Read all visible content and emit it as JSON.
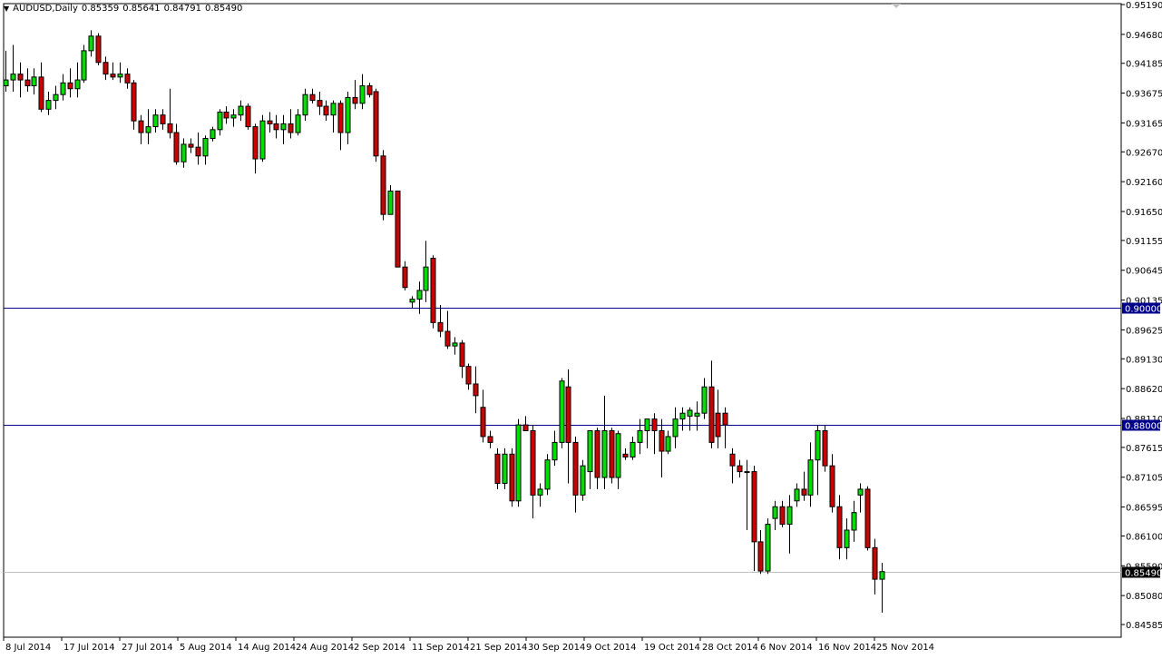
{
  "header": {
    "symbol": "AUDUSD,Daily",
    "open": "0.85359",
    "high": "0.85641",
    "low": "0.84791",
    "close": "0.85490"
  },
  "chart_data": {
    "type": "candlestick",
    "y_axis": {
      "range": [
        0.8443,
        0.9519
      ],
      "tick_labels": [
        "0.95190",
        "0.94680",
        "0.94185",
        "0.93675",
        "0.93165",
        "0.92670",
        "0.92160",
        "0.91650",
        "0.91155",
        "0.90645",
        "0.90135",
        "0.89625",
        "0.89130",
        "0.88620",
        "0.88110",
        "0.87615",
        "0.87105",
        "0.86595",
        "0.86100",
        "0.85590",
        "0.85080",
        "0.84585"
      ]
    },
    "x_axis": {
      "tick_labels": [
        "8 Jul 2014",
        "17 Jul 2014",
        "27 Jul 2014",
        "5 Aug 2014",
        "14 Aug 2014",
        "24 Aug 2014",
        "2 Sep 2014",
        "11 Sep 2014",
        "21 Sep 2014",
        "30 Sep 2014",
        "9 Oct 2014",
        "19 Oct 2014",
        "28 Oct 2014",
        "6 Nov 2014",
        "16 Nov 2014",
        "25 Nov 2014"
      ]
    },
    "horizontal_lines": [
      {
        "price": 0.9,
        "label": "0.90000",
        "color": "#00008b"
      },
      {
        "price": 0.88,
        "label": "0.88000",
        "color": "#00008b"
      },
      {
        "price": 0.8549,
        "label": "0.85490",
        "color": "#c0c0c0"
      }
    ],
    "colors": {
      "bull": "#00dd00",
      "bear": "#cc0000",
      "wick": "#000000"
    },
    "candles": [
      {
        "o": 0.938,
        "h": 0.944,
        "l": 0.937,
        "c": 0.939
      },
      {
        "o": 0.939,
        "h": 0.945,
        "l": 0.937,
        "c": 0.94
      },
      {
        "o": 0.94,
        "h": 0.942,
        "l": 0.936,
        "c": 0.939
      },
      {
        "o": 0.939,
        "h": 0.941,
        "l": 0.937,
        "c": 0.938
      },
      {
        "o": 0.938,
        "h": 0.941,
        "l": 0.9365,
        "c": 0.9395
      },
      {
        "o": 0.9395,
        "h": 0.942,
        "l": 0.9335,
        "c": 0.934
      },
      {
        "o": 0.934,
        "h": 0.937,
        "l": 0.933,
        "c": 0.9355
      },
      {
        "o": 0.9355,
        "h": 0.938,
        "l": 0.934,
        "c": 0.9365
      },
      {
        "o": 0.9365,
        "h": 0.94,
        "l": 0.9355,
        "c": 0.9385
      },
      {
        "o": 0.9385,
        "h": 0.941,
        "l": 0.936,
        "c": 0.9375
      },
      {
        "o": 0.9375,
        "h": 0.942,
        "l": 0.936,
        "c": 0.939
      },
      {
        "o": 0.939,
        "h": 0.945,
        "l": 0.9385,
        "c": 0.944
      },
      {
        "o": 0.944,
        "h": 0.9475,
        "l": 0.943,
        "c": 0.9465
      },
      {
        "o": 0.9465,
        "h": 0.947,
        "l": 0.9415,
        "c": 0.942
      },
      {
        "o": 0.942,
        "h": 0.943,
        "l": 0.939,
        "c": 0.94
      },
      {
        "o": 0.94,
        "h": 0.942,
        "l": 0.939,
        "c": 0.9395
      },
      {
        "o": 0.9395,
        "h": 0.942,
        "l": 0.9385,
        "c": 0.94
      },
      {
        "o": 0.94,
        "h": 0.941,
        "l": 0.9375,
        "c": 0.9385
      },
      {
        "o": 0.9385,
        "h": 0.939,
        "l": 0.9305,
        "c": 0.932
      },
      {
        "o": 0.932,
        "h": 0.933,
        "l": 0.928,
        "c": 0.93
      },
      {
        "o": 0.93,
        "h": 0.934,
        "l": 0.928,
        "c": 0.931
      },
      {
        "o": 0.931,
        "h": 0.934,
        "l": 0.93,
        "c": 0.933
      },
      {
        "o": 0.933,
        "h": 0.934,
        "l": 0.9305,
        "c": 0.9315
      },
      {
        "o": 0.9315,
        "h": 0.9375,
        "l": 0.929,
        "c": 0.93
      },
      {
        "o": 0.93,
        "h": 0.9315,
        "l": 0.9245,
        "c": 0.925
      },
      {
        "o": 0.925,
        "h": 0.929,
        "l": 0.924,
        "c": 0.928
      },
      {
        "o": 0.928,
        "h": 0.929,
        "l": 0.9265,
        "c": 0.9275
      },
      {
        "o": 0.9275,
        "h": 0.93,
        "l": 0.9245,
        "c": 0.926
      },
      {
        "o": 0.926,
        "h": 0.9295,
        "l": 0.9245,
        "c": 0.929
      },
      {
        "o": 0.929,
        "h": 0.931,
        "l": 0.9285,
        "c": 0.9305
      },
      {
        "o": 0.9305,
        "h": 0.934,
        "l": 0.9295,
        "c": 0.9335
      },
      {
        "o": 0.9335,
        "h": 0.9345,
        "l": 0.9315,
        "c": 0.9325
      },
      {
        "o": 0.9325,
        "h": 0.934,
        "l": 0.931,
        "c": 0.933
      },
      {
        "o": 0.933,
        "h": 0.9355,
        "l": 0.932,
        "c": 0.9345
      },
      {
        "o": 0.9345,
        "h": 0.935,
        "l": 0.9305,
        "c": 0.931
      },
      {
        "o": 0.931,
        "h": 0.9315,
        "l": 0.923,
        "c": 0.9255
      },
      {
        "o": 0.9255,
        "h": 0.933,
        "l": 0.925,
        "c": 0.932
      },
      {
        "o": 0.932,
        "h": 0.9335,
        "l": 0.93,
        "c": 0.9315
      },
      {
        "o": 0.9315,
        "h": 0.933,
        "l": 0.929,
        "c": 0.9305
      },
      {
        "o": 0.9305,
        "h": 0.933,
        "l": 0.928,
        "c": 0.9315
      },
      {
        "o": 0.9315,
        "h": 0.934,
        "l": 0.929,
        "c": 0.93
      },
      {
        "o": 0.93,
        "h": 0.934,
        "l": 0.9295,
        "c": 0.933
      },
      {
        "o": 0.933,
        "h": 0.9375,
        "l": 0.932,
        "c": 0.9365
      },
      {
        "o": 0.9365,
        "h": 0.9375,
        "l": 0.935,
        "c": 0.9355
      },
      {
        "o": 0.9355,
        "h": 0.937,
        "l": 0.933,
        "c": 0.9345
      },
      {
        "o": 0.9345,
        "h": 0.9355,
        "l": 0.932,
        "c": 0.933
      },
      {
        "o": 0.933,
        "h": 0.9355,
        "l": 0.93,
        "c": 0.935
      },
      {
        "o": 0.935,
        "h": 0.9355,
        "l": 0.927,
        "c": 0.93
      },
      {
        "o": 0.93,
        "h": 0.937,
        "l": 0.928,
        "c": 0.936
      },
      {
        "o": 0.936,
        "h": 0.939,
        "l": 0.934,
        "c": 0.935
      },
      {
        "o": 0.935,
        "h": 0.94,
        "l": 0.934,
        "c": 0.938
      },
      {
        "o": 0.938,
        "h": 0.9385,
        "l": 0.936,
        "c": 0.9365
      },
      {
        "o": 0.937,
        "h": 0.9375,
        "l": 0.925,
        "c": 0.926
      },
      {
        "o": 0.926,
        "h": 0.927,
        "l": 0.915,
        "c": 0.916
      },
      {
        "o": 0.916,
        "h": 0.921,
        "l": 0.916,
        "c": 0.92
      },
      {
        "o": 0.92,
        "h": 0.92,
        "l": 0.91,
        "c": 0.907
      },
      {
        "o": 0.907,
        "h": 0.908,
        "l": 0.903,
        "c": 0.9035
      },
      {
        "o": 0.901,
        "h": 0.902,
        "l": 0.9,
        "c": 0.9015
      },
      {
        "o": 0.9015,
        "h": 0.9045,
        "l": 0.899,
        "c": 0.903
      },
      {
        "o": 0.903,
        "h": 0.9115,
        "l": 0.901,
        "c": 0.907
      },
      {
        "o": 0.9085,
        "h": 0.909,
        "l": 0.8965,
        "c": 0.8975
      },
      {
        "o": 0.8975,
        "h": 0.9005,
        "l": 0.895,
        "c": 0.896
      },
      {
        "o": 0.896,
        "h": 0.8995,
        "l": 0.893,
        "c": 0.8935
      },
      {
        "o": 0.8935,
        "h": 0.895,
        "l": 0.892,
        "c": 0.894
      },
      {
        "o": 0.894,
        "h": 0.8945,
        "l": 0.888,
        "c": 0.89
      },
      {
        "o": 0.89,
        "h": 0.8905,
        "l": 0.886,
        "c": 0.887
      },
      {
        "o": 0.887,
        "h": 0.89,
        "l": 0.882,
        "c": 0.885
      },
      {
        "o": 0.883,
        "h": 0.886,
        "l": 0.877,
        "c": 0.878
      },
      {
        "o": 0.878,
        "h": 0.879,
        "l": 0.876,
        "c": 0.877
      },
      {
        "o": 0.875,
        "h": 0.876,
        "l": 0.869,
        "c": 0.87
      },
      {
        "o": 0.87,
        "h": 0.876,
        "l": 0.869,
        "c": 0.875
      },
      {
        "o": 0.875,
        "h": 0.876,
        "l": 0.866,
        "c": 0.867
      },
      {
        "o": 0.867,
        "h": 0.881,
        "l": 0.866,
        "c": 0.88
      },
      {
        "o": 0.88,
        "h": 0.8815,
        "l": 0.879,
        "c": 0.879
      },
      {
        "o": 0.879,
        "h": 0.88,
        "l": 0.864,
        "c": 0.868
      },
      {
        "o": 0.868,
        "h": 0.87,
        "l": 0.866,
        "c": 0.869
      },
      {
        "o": 0.869,
        "h": 0.875,
        "l": 0.868,
        "c": 0.874
      },
      {
        "o": 0.874,
        "h": 0.879,
        "l": 0.873,
        "c": 0.877
      },
      {
        "o": 0.877,
        "h": 0.888,
        "l": 0.876,
        "c": 0.8875
      },
      {
        "o": 0.8865,
        "h": 0.8895,
        "l": 0.87,
        "c": 0.877
      },
      {
        "o": 0.877,
        "h": 0.878,
        "l": 0.865,
        "c": 0.868
      },
      {
        "o": 0.868,
        "h": 0.874,
        "l": 0.867,
        "c": 0.873
      },
      {
        "o": 0.872,
        "h": 0.879,
        "l": 0.869,
        "c": 0.879
      },
      {
        "o": 0.879,
        "h": 0.8795,
        "l": 0.869,
        "c": 0.871
      },
      {
        "o": 0.871,
        "h": 0.885,
        "l": 0.869,
        "c": 0.879
      },
      {
        "o": 0.879,
        "h": 0.8795,
        "l": 0.87,
        "c": 0.871
      },
      {
        "o": 0.871,
        "h": 0.879,
        "l": 0.869,
        "c": 0.8785
      },
      {
        "o": 0.875,
        "h": 0.876,
        "l": 0.874,
        "c": 0.8745
      },
      {
        "o": 0.8745,
        "h": 0.878,
        "l": 0.874,
        "c": 0.877
      },
      {
        "o": 0.877,
        "h": 0.881,
        "l": 0.875,
        "c": 0.879
      },
      {
        "o": 0.879,
        "h": 0.881,
        "l": 0.876,
        "c": 0.881
      },
      {
        "o": 0.881,
        "h": 0.882,
        "l": 0.875,
        "c": 0.879
      },
      {
        "o": 0.879,
        "h": 0.881,
        "l": 0.871,
        "c": 0.8755
      },
      {
        "o": 0.8755,
        "h": 0.879,
        "l": 0.875,
        "c": 0.878
      },
      {
        "o": 0.878,
        "h": 0.883,
        "l": 0.876,
        "c": 0.881
      },
      {
        "o": 0.881,
        "h": 0.883,
        "l": 0.879,
        "c": 0.882
      },
      {
        "o": 0.8815,
        "h": 0.883,
        "l": 0.879,
        "c": 0.8825
      },
      {
        "o": 0.8815,
        "h": 0.884,
        "l": 0.879,
        "c": 0.882
      },
      {
        "o": 0.882,
        "h": 0.888,
        "l": 0.881,
        "c": 0.8865
      },
      {
        "o": 0.8865,
        "h": 0.891,
        "l": 0.876,
        "c": 0.877
      },
      {
        "o": 0.882,
        "h": 0.886,
        "l": 0.876,
        "c": 0.878
      },
      {
        "o": 0.882,
        "h": 0.883,
        "l": 0.876,
        "c": 0.88
      },
      {
        "o": 0.875,
        "h": 0.876,
        "l": 0.87,
        "c": 0.873
      },
      {
        "o": 0.873,
        "h": 0.874,
        "l": 0.871,
        "c": 0.872
      },
      {
        "o": 0.872,
        "h": 0.874,
        "l": 0.862,
        "c": 0.872
      },
      {
        "o": 0.872,
        "h": 0.873,
        "l": 0.855,
        "c": 0.86
      },
      {
        "o": 0.86,
        "h": 0.862,
        "l": 0.8545,
        "c": 0.855
      },
      {
        "o": 0.855,
        "h": 0.864,
        "l": 0.8545,
        "c": 0.863
      },
      {
        "o": 0.864,
        "h": 0.867,
        "l": 0.862,
        "c": 0.866
      },
      {
        "o": 0.866,
        "h": 0.867,
        "l": 0.8625,
        "c": 0.863
      },
      {
        "o": 0.863,
        "h": 0.868,
        "l": 0.858,
        "c": 0.866
      },
      {
        "o": 0.867,
        "h": 0.87,
        "l": 0.866,
        "c": 0.869
      },
      {
        "o": 0.869,
        "h": 0.872,
        "l": 0.867,
        "c": 0.868
      },
      {
        "o": 0.868,
        "h": 0.877,
        "l": 0.866,
        "c": 0.874
      },
      {
        "o": 0.874,
        "h": 0.88,
        "l": 0.868,
        "c": 0.879
      },
      {
        "o": 0.879,
        "h": 0.88,
        "l": 0.872,
        "c": 0.873
      },
      {
        "o": 0.873,
        "h": 0.875,
        "l": 0.865,
        "c": 0.866
      },
      {
        "o": 0.866,
        "h": 0.868,
        "l": 0.857,
        "c": 0.859
      },
      {
        "o": 0.859,
        "h": 0.864,
        "l": 0.857,
        "c": 0.862
      },
      {
        "o": 0.862,
        "h": 0.867,
        "l": 0.86,
        "c": 0.865
      },
      {
        "o": 0.868,
        "h": 0.87,
        "l": 0.865,
        "c": 0.869
      },
      {
        "o": 0.869,
        "h": 0.8695,
        "l": 0.8585,
        "c": 0.859
      },
      {
        "o": 0.859,
        "h": 0.8605,
        "l": 0.851,
        "c": 0.8536
      },
      {
        "o": 0.8536,
        "h": 0.8564,
        "l": 0.8479,
        "c": 0.8549
      }
    ]
  }
}
